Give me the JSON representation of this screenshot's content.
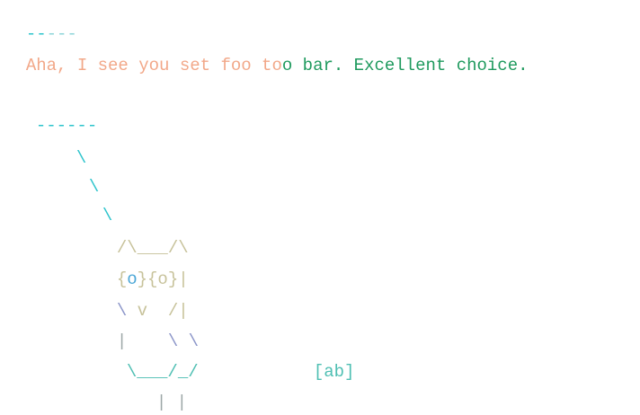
{
  "top_dashes": [
    {
      "text": "--",
      "color": "#2ec4cc"
    },
    {
      "text": "---",
      "color": "#8fd6d9"
    }
  ],
  "message": {
    "segments": [
      {
        "text": "Aha, I see you set foo to",
        "color": "#f2a889"
      },
      {
        "text": "o bar. Excellent choice.",
        "color": "#1f9a5e"
      }
    ]
  },
  "owl_dashes": "------",
  "owl": {
    "line_slash_1": "\\",
    "line_slash_2": "\\",
    "line_slash_3": "\\",
    "ears": "/\\___/\\",
    "eyes": [
      {
        "text": "{",
        "color": "#c7c29a"
      },
      {
        "text": "o",
        "color": "#4aa6d6"
      },
      {
        "text": "}{o}|",
        "color": "#c7c29a"
      }
    ],
    "beak": [
      {
        "text": "\\ ",
        "color": "#8c96c9"
      },
      {
        "text": "v  /|",
        "color": "#c7c29a"
      }
    ],
    "body": [
      {
        "text": "|",
        "color": "#9da7a7"
      },
      {
        "text": "    \\ \\",
        "color": "#8c96c9"
      }
    ],
    "bottom": [
      {
        "text": "\\___/_/",
        "color": "#4fbfb3"
      }
    ],
    "tag": "[ab]",
    "feet": "| |"
  }
}
